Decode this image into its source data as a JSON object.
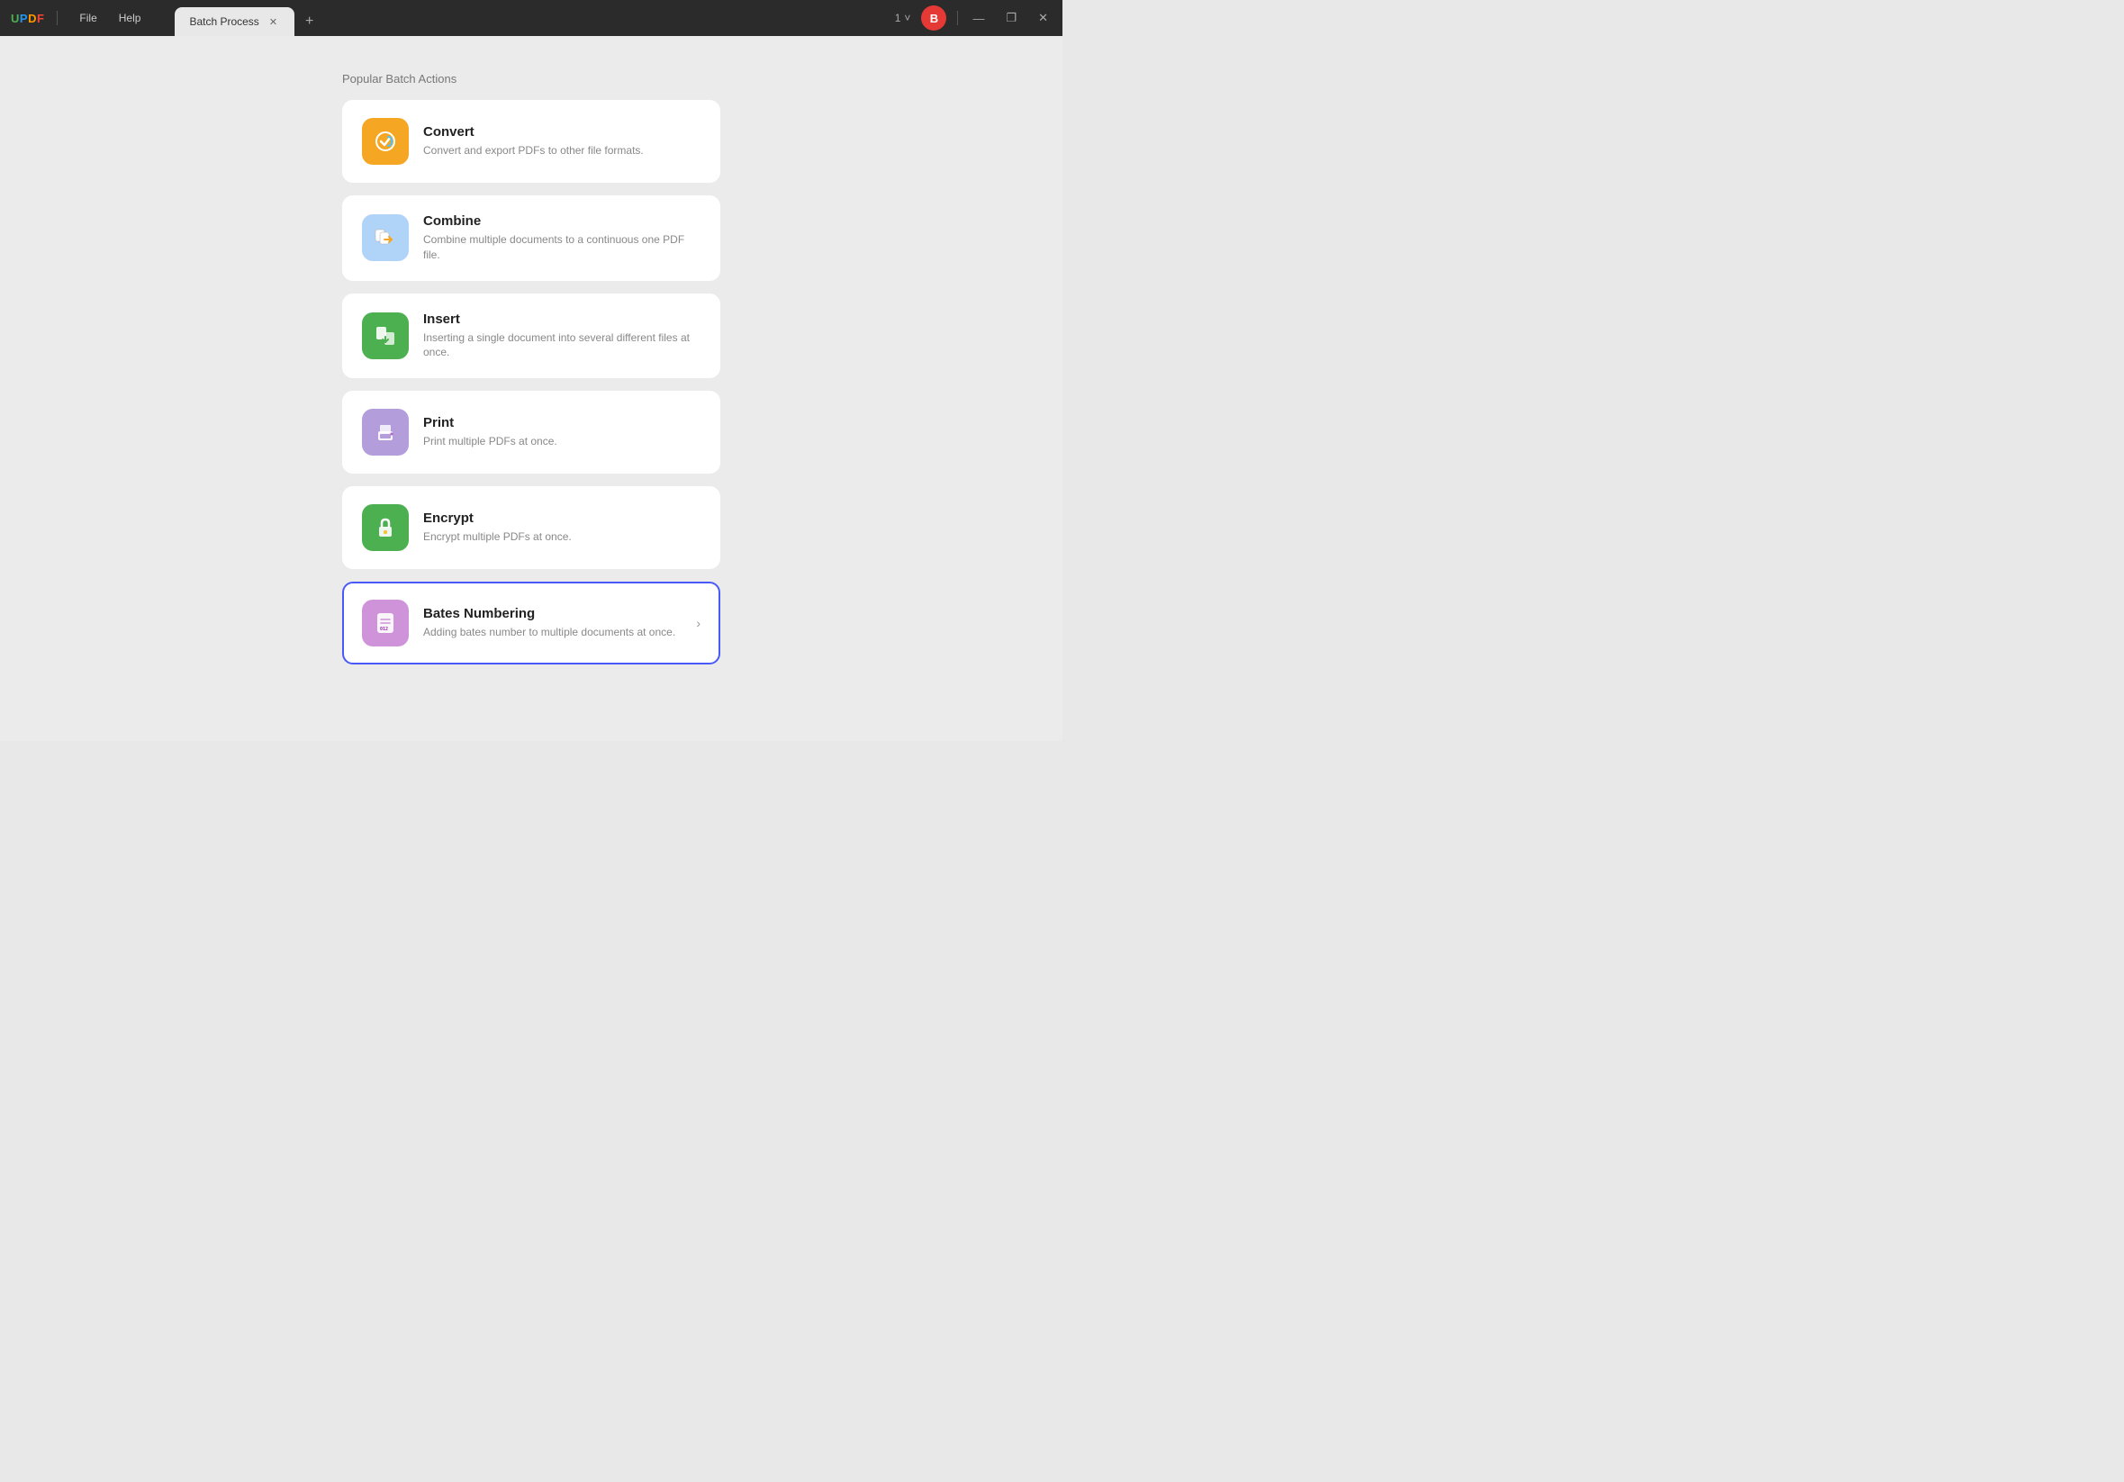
{
  "app": {
    "logo": {
      "u": "U",
      "p": "P",
      "d": "D",
      "f": "F"
    },
    "menus": [
      {
        "label": "File",
        "id": "file"
      },
      {
        "label": "Help",
        "id": "help"
      }
    ],
    "tab": {
      "title": "Batch Process",
      "close_icon": "✕"
    },
    "tab_add_icon": "+",
    "window_counter": "1",
    "window_counter_chevron": "˅",
    "user_initial": "B",
    "window_controls": {
      "minimize": "—",
      "maximize": "❐",
      "close": "✕"
    }
  },
  "main": {
    "section_title": "Popular Batch Actions",
    "actions": [
      {
        "id": "convert",
        "title": "Convert",
        "description": "Convert and export PDFs to other file formats.",
        "icon_color": "convert",
        "has_arrow": false,
        "selected": false
      },
      {
        "id": "combine",
        "title": "Combine",
        "description": "Combine multiple documents to a continuous one PDF file.",
        "icon_color": "combine",
        "has_arrow": false,
        "selected": false
      },
      {
        "id": "insert",
        "title": "Insert",
        "description": "Inserting a single document into several different files at once.",
        "icon_color": "insert",
        "has_arrow": false,
        "selected": false
      },
      {
        "id": "print",
        "title": "Print",
        "description": "Print multiple PDFs at once.",
        "icon_color": "print",
        "has_arrow": false,
        "selected": false
      },
      {
        "id": "encrypt",
        "title": "Encrypt",
        "description": "Encrypt multiple PDFs at once.",
        "icon_color": "encrypt",
        "has_arrow": false,
        "selected": false
      },
      {
        "id": "bates",
        "title": "Bates Numbering",
        "description": "Adding bates number to multiple documents at once.",
        "icon_color": "bates",
        "has_arrow": true,
        "selected": true
      }
    ]
  }
}
